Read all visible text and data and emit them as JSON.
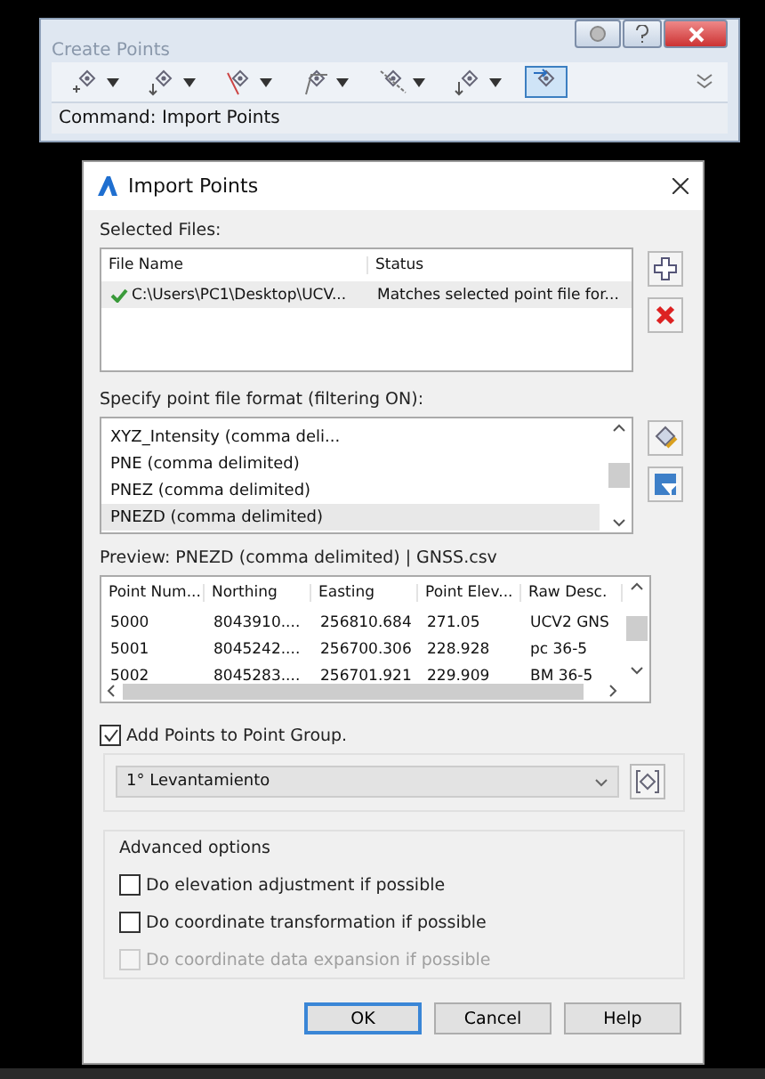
{
  "palette": {
    "title": "Create Points",
    "tools": [
      {
        "dropdown": true,
        "selected": false
      },
      {
        "dropdown": true,
        "selected": false
      },
      {
        "dropdown": true,
        "selected": false
      },
      {
        "dropdown": true,
        "selected": false
      },
      {
        "dropdown": true,
        "selected": false
      },
      {
        "dropdown": true,
        "selected": false
      },
      {
        "dropdown": false,
        "selected": true
      }
    ],
    "command": "Command: Import Points"
  },
  "dialog": {
    "title": "Import Points",
    "selected_files": {
      "label": "Selected Files:",
      "columns": [
        "File Name",
        "Status"
      ],
      "rows": [
        {
          "file_name": "C:\\Users\\PC1\\Desktop\\UCV...",
          "status": "Matches selected point file for...",
          "valid": true,
          "selected": true
        }
      ]
    },
    "format": {
      "label": "Specify point file format (filtering ON):",
      "items": [
        {
          "label": "XYZ_Intensity (comma deli...",
          "selected": false
        },
        {
          "label": "PNE (comma delimited)",
          "selected": false
        },
        {
          "label": "PNEZ (comma delimited)",
          "selected": false
        },
        {
          "label": "PNEZD (comma delimited)",
          "selected": true
        }
      ]
    },
    "preview": {
      "label": "Preview: PNEZD (comma delimited) | GNSS.csv",
      "columns": [
        "Point Num...",
        "Northing",
        "Easting",
        "Point Elev...",
        "Raw Desc."
      ],
      "rows": [
        [
          "5000",
          "8043910....",
          "256810.684",
          "271.05",
          "UCV2 GNS"
        ],
        [
          "5001",
          "8045242....",
          "256700.306",
          "228.928",
          "pc 36-5"
        ],
        [
          "5002",
          "8045283....",
          "256701.921",
          "229.909",
          "BM 36-5"
        ]
      ]
    },
    "group": {
      "label": "Add Points to Point Group.",
      "checked": true,
      "value": "1° Levantamiento"
    },
    "advanced": {
      "title": "Advanced options",
      "options": [
        {
          "label": "Do elevation adjustment if possible",
          "checked": false,
          "disabled": false
        },
        {
          "label": "Do coordinate transformation if possible",
          "checked": false,
          "disabled": false
        },
        {
          "label": "Do coordinate data expansion if possible",
          "checked": false,
          "disabled": true
        }
      ]
    },
    "buttons": [
      {
        "label": "OK",
        "default": true
      },
      {
        "label": "Cancel",
        "default": false
      },
      {
        "label": "Help",
        "default": false
      }
    ]
  }
}
